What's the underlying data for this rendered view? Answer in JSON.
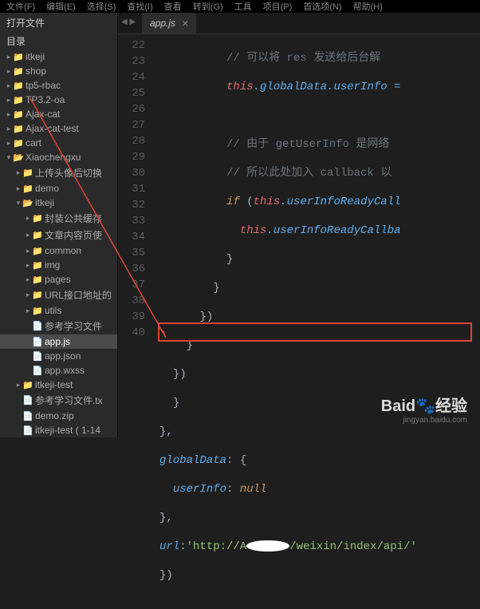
{
  "menubar": [
    "文件(F)",
    "编辑(E)",
    "选择(S)",
    "查找(I)",
    "查看",
    "转到(G)",
    "工具",
    "项目(P)",
    "首选项(N)",
    "帮助(H)"
  ],
  "sidebar": {
    "header": "打开文件",
    "title": "目录",
    "items": [
      {
        "l": 1,
        "arrow": "▸",
        "icon": "📁",
        "label": "itkeji"
      },
      {
        "l": 1,
        "arrow": "▸",
        "icon": "📁",
        "label": "shop"
      },
      {
        "l": 1,
        "arrow": "▸",
        "icon": "📁",
        "label": "tp5-rbac"
      },
      {
        "l": 1,
        "arrow": "▸",
        "icon": "📁",
        "label": "TP3.2-oa"
      },
      {
        "l": 1,
        "arrow": "▸",
        "icon": "📁",
        "label": "Ajax-cat"
      },
      {
        "l": 1,
        "arrow": "▸",
        "icon": "📁",
        "label": "Ajax-cat-test"
      },
      {
        "l": 1,
        "arrow": "▸",
        "icon": "📁",
        "label": "cart"
      },
      {
        "l": 1,
        "arrow": "▾",
        "icon": "📂",
        "label": "Xiaochengxu"
      },
      {
        "l": 2,
        "arrow": "▸",
        "icon": "📁",
        "label": "上传头像后切换"
      },
      {
        "l": 2,
        "arrow": "▸",
        "icon": "📁",
        "label": "demo"
      },
      {
        "l": 2,
        "arrow": "▾",
        "icon": "📂",
        "label": "itkeji"
      },
      {
        "l": 3,
        "arrow": "▸",
        "icon": "📁",
        "label": "封装公共缓存"
      },
      {
        "l": 3,
        "arrow": "▸",
        "icon": "📁",
        "label": "文章内容页使"
      },
      {
        "l": 3,
        "arrow": "▸",
        "icon": "📁",
        "label": "common"
      },
      {
        "l": 3,
        "arrow": "▸",
        "icon": "📁",
        "label": "img"
      },
      {
        "l": 3,
        "arrow": "▸",
        "icon": "📁",
        "label": "pages"
      },
      {
        "l": 3,
        "arrow": "▸",
        "icon": "📁",
        "label": "URL接口地址的"
      },
      {
        "l": 3,
        "arrow": "▸",
        "icon": "📁",
        "label": "utils"
      },
      {
        "l": 3,
        "arrow": "",
        "icon": "📄",
        "label": "参考学习文件"
      },
      {
        "l": 3,
        "arrow": "",
        "icon": "📄",
        "label": "app.js",
        "selected": true
      },
      {
        "l": 3,
        "arrow": "",
        "icon": "📄",
        "label": "app.json"
      },
      {
        "l": 3,
        "arrow": "",
        "icon": "📄",
        "label": "app.wxss"
      },
      {
        "l": 2,
        "arrow": "▸",
        "icon": "📁",
        "label": "itkeji-test"
      },
      {
        "l": 2,
        "arrow": "",
        "icon": "📄",
        "label": "参考学习文件.tx"
      },
      {
        "l": 2,
        "arrow": "",
        "icon": "📄",
        "label": "demo.zip"
      },
      {
        "l": 2,
        "arrow": "",
        "icon": "📄",
        "label": "itkeji-test  ( 1-14"
      }
    ]
  },
  "tab": {
    "title": "app.js",
    "close": "×"
  },
  "gutter": [
    "22",
    "23",
    "24",
    "25",
    "26",
    "27",
    "28",
    "29",
    "30",
    "31",
    "32",
    "33",
    "34",
    "35",
    "36",
    "37",
    "38",
    "39",
    "40"
  ],
  "code": {
    "l22": "// 可以将 res 发送给后台解",
    "l23a": "this",
    "l23b": ".globalData.userInfo =",
    "l25": "// 由于 getUserInfo 是网络",
    "l26": "// 所以此处加入 callback 以",
    "l27a": "if",
    "l27b": " (",
    "l27c": "this",
    "l27d": ".userInfoReadyCall",
    "l28a": "this",
    "l28b": ".userInfoReadyCallba",
    "l29": "}",
    "l30": "}",
    "l31": "})",
    "l32": "}",
    "l33": "})",
    "l34": "}",
    "l35": "},",
    "l36a": "globalData",
    "l36b": ": {",
    "l37a": "userInfo",
    "l37b": ": ",
    "l37c": "null",
    "l38": "},",
    "l39a": "url",
    "l39b": ":",
    "l39c1": "'http://A",
    "l39c2": "/weixin/index/api/'",
    "l40": "})"
  },
  "watermark": {
    "logo": "Baid",
    "logo2": "经验",
    "url": "jingyan.baidu.com"
  }
}
